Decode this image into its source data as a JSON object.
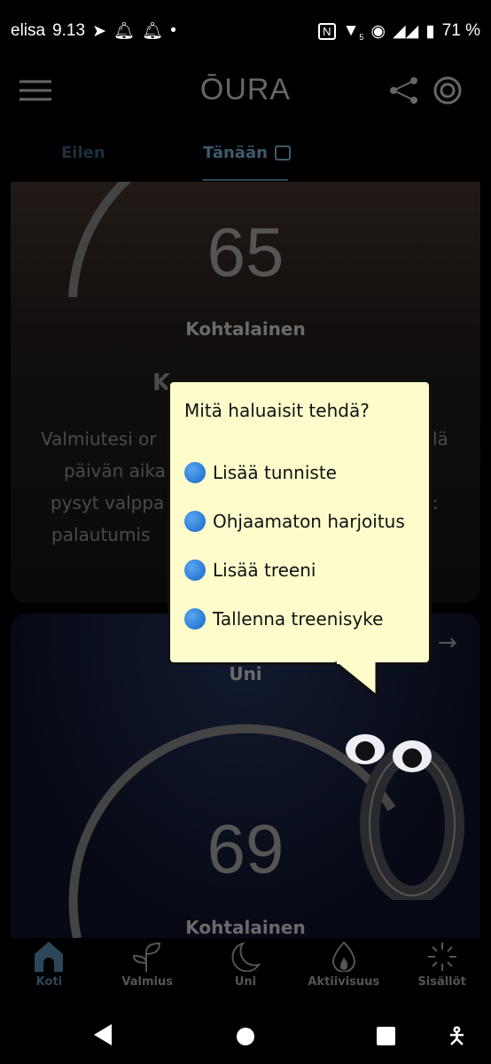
{
  "status_bar": {
    "carrier": "elisa",
    "time": "9.13",
    "battery": "71 %",
    "network_badge": "5"
  },
  "header": {
    "logo": "ŌURA",
    "menu_icon": "hamburger-icon",
    "share_icon": "share-icon",
    "ring_icon": "ring-status-icon"
  },
  "tabs": [
    {
      "label": "Eilen"
    },
    {
      "label": "Tänään",
      "icon": "calendar-icon",
      "active": true
    }
  ],
  "readiness_card": {
    "score": "65",
    "level": "Kohtalainen",
    "heading": "K",
    "lines_left": [
      "Valmiutesi or",
      "päivän aika",
      "pysyt valppa",
      "palautumis"
    ],
    "lines_right": [
      "lä",
      "",
      ":",
      ""
    ]
  },
  "sleep_card": {
    "title": "Uni",
    "score": "69",
    "level": "Kohtalainen"
  },
  "popup": {
    "question": "Mitä haluaisit tehdä?",
    "items": [
      "Lisää tunniste",
      "Ohjaamaton harjoitus",
      "Lisää treeni",
      "Tallenna treenisyke"
    ]
  },
  "bottom_nav": [
    {
      "label": "Koti",
      "icon": "home-icon",
      "active": true
    },
    {
      "label": "Valmius",
      "icon": "sprout-icon"
    },
    {
      "label": "Uni",
      "icon": "moon-icon"
    },
    {
      "label": "Aktiivisuus",
      "icon": "flame-icon"
    },
    {
      "label": "Sisällöt",
      "icon": "sparkle-icon"
    }
  ],
  "colors": {
    "popup_bg": "#fffccc",
    "active_nav": "#2c4759",
    "bullet": "#1e78d8"
  }
}
